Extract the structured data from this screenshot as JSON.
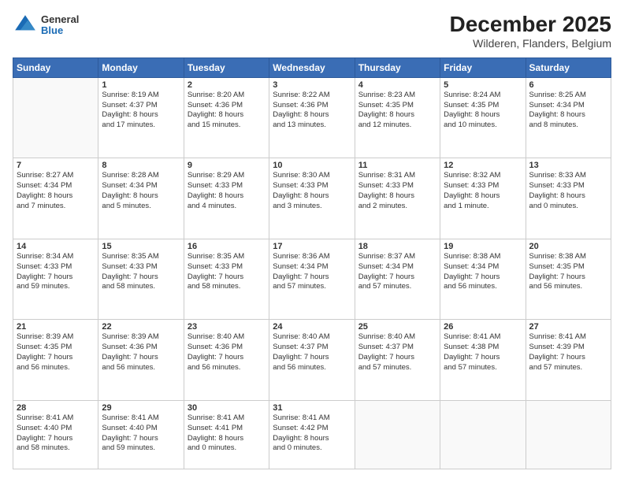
{
  "logo": {
    "general": "General",
    "blue": "Blue"
  },
  "header": {
    "month": "December 2025",
    "location": "Wilderen, Flanders, Belgium"
  },
  "weekdays": [
    "Sunday",
    "Monday",
    "Tuesday",
    "Wednesday",
    "Thursday",
    "Friday",
    "Saturday"
  ],
  "weeks": [
    [
      {
        "day": "",
        "info": ""
      },
      {
        "day": "1",
        "info": "Sunrise: 8:19 AM\nSunset: 4:37 PM\nDaylight: 8 hours\nand 17 minutes."
      },
      {
        "day": "2",
        "info": "Sunrise: 8:20 AM\nSunset: 4:36 PM\nDaylight: 8 hours\nand 15 minutes."
      },
      {
        "day": "3",
        "info": "Sunrise: 8:22 AM\nSunset: 4:36 PM\nDaylight: 8 hours\nand 13 minutes."
      },
      {
        "day": "4",
        "info": "Sunrise: 8:23 AM\nSunset: 4:35 PM\nDaylight: 8 hours\nand 12 minutes."
      },
      {
        "day": "5",
        "info": "Sunrise: 8:24 AM\nSunset: 4:35 PM\nDaylight: 8 hours\nand 10 minutes."
      },
      {
        "day": "6",
        "info": "Sunrise: 8:25 AM\nSunset: 4:34 PM\nDaylight: 8 hours\nand 8 minutes."
      }
    ],
    [
      {
        "day": "7",
        "info": "Sunrise: 8:27 AM\nSunset: 4:34 PM\nDaylight: 8 hours\nand 7 minutes."
      },
      {
        "day": "8",
        "info": "Sunrise: 8:28 AM\nSunset: 4:34 PM\nDaylight: 8 hours\nand 5 minutes."
      },
      {
        "day": "9",
        "info": "Sunrise: 8:29 AM\nSunset: 4:33 PM\nDaylight: 8 hours\nand 4 minutes."
      },
      {
        "day": "10",
        "info": "Sunrise: 8:30 AM\nSunset: 4:33 PM\nDaylight: 8 hours\nand 3 minutes."
      },
      {
        "day": "11",
        "info": "Sunrise: 8:31 AM\nSunset: 4:33 PM\nDaylight: 8 hours\nand 2 minutes."
      },
      {
        "day": "12",
        "info": "Sunrise: 8:32 AM\nSunset: 4:33 PM\nDaylight: 8 hours\nand 1 minute."
      },
      {
        "day": "13",
        "info": "Sunrise: 8:33 AM\nSunset: 4:33 PM\nDaylight: 8 hours\nand 0 minutes."
      }
    ],
    [
      {
        "day": "14",
        "info": "Sunrise: 8:34 AM\nSunset: 4:33 PM\nDaylight: 7 hours\nand 59 minutes."
      },
      {
        "day": "15",
        "info": "Sunrise: 8:35 AM\nSunset: 4:33 PM\nDaylight: 7 hours\nand 58 minutes."
      },
      {
        "day": "16",
        "info": "Sunrise: 8:35 AM\nSunset: 4:33 PM\nDaylight: 7 hours\nand 58 minutes."
      },
      {
        "day": "17",
        "info": "Sunrise: 8:36 AM\nSunset: 4:34 PM\nDaylight: 7 hours\nand 57 minutes."
      },
      {
        "day": "18",
        "info": "Sunrise: 8:37 AM\nSunset: 4:34 PM\nDaylight: 7 hours\nand 57 minutes."
      },
      {
        "day": "19",
        "info": "Sunrise: 8:38 AM\nSunset: 4:34 PM\nDaylight: 7 hours\nand 56 minutes."
      },
      {
        "day": "20",
        "info": "Sunrise: 8:38 AM\nSunset: 4:35 PM\nDaylight: 7 hours\nand 56 minutes."
      }
    ],
    [
      {
        "day": "21",
        "info": "Sunrise: 8:39 AM\nSunset: 4:35 PM\nDaylight: 7 hours\nand 56 minutes."
      },
      {
        "day": "22",
        "info": "Sunrise: 8:39 AM\nSunset: 4:36 PM\nDaylight: 7 hours\nand 56 minutes."
      },
      {
        "day": "23",
        "info": "Sunrise: 8:40 AM\nSunset: 4:36 PM\nDaylight: 7 hours\nand 56 minutes."
      },
      {
        "day": "24",
        "info": "Sunrise: 8:40 AM\nSunset: 4:37 PM\nDaylight: 7 hours\nand 56 minutes."
      },
      {
        "day": "25",
        "info": "Sunrise: 8:40 AM\nSunset: 4:37 PM\nDaylight: 7 hours\nand 57 minutes."
      },
      {
        "day": "26",
        "info": "Sunrise: 8:41 AM\nSunset: 4:38 PM\nDaylight: 7 hours\nand 57 minutes."
      },
      {
        "day": "27",
        "info": "Sunrise: 8:41 AM\nSunset: 4:39 PM\nDaylight: 7 hours\nand 57 minutes."
      }
    ],
    [
      {
        "day": "28",
        "info": "Sunrise: 8:41 AM\nSunset: 4:40 PM\nDaylight: 7 hours\nand 58 minutes."
      },
      {
        "day": "29",
        "info": "Sunrise: 8:41 AM\nSunset: 4:40 PM\nDaylight: 7 hours\nand 59 minutes."
      },
      {
        "day": "30",
        "info": "Sunrise: 8:41 AM\nSunset: 4:41 PM\nDaylight: 8 hours\nand 0 minutes."
      },
      {
        "day": "31",
        "info": "Sunrise: 8:41 AM\nSunset: 4:42 PM\nDaylight: 8 hours\nand 0 minutes."
      },
      {
        "day": "",
        "info": ""
      },
      {
        "day": "",
        "info": ""
      },
      {
        "day": "",
        "info": ""
      }
    ]
  ]
}
